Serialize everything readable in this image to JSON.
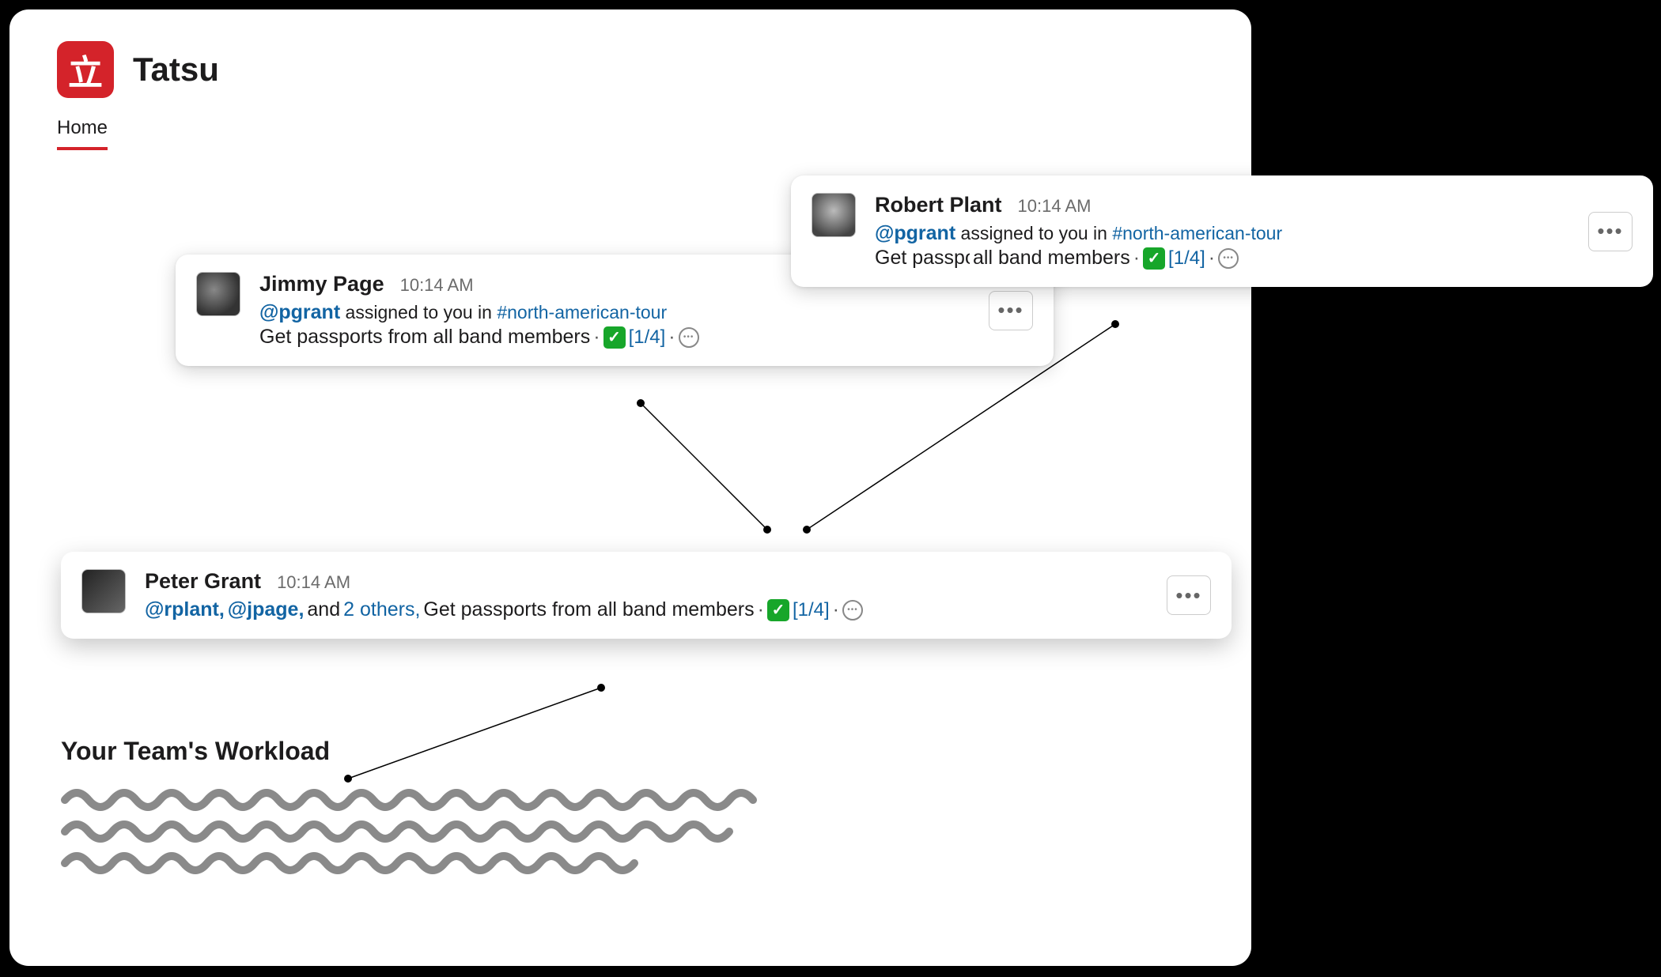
{
  "app": {
    "title": "Tatsu",
    "tab_home": "Home"
  },
  "cards": {
    "jimmy": {
      "name": "Jimmy Page",
      "time": "10:14 AM",
      "mention": "@pgrant",
      "assigned_phrase": "assigned to you in",
      "channel": "#north-american-tour",
      "task": "Get passports from all band members",
      "progress": "[1/4]"
    },
    "robert": {
      "name": "Robert Plant",
      "time": "10:14 AM",
      "mention": "@pgrant",
      "assigned_phrase": "assigned to you in",
      "channel": "#north-american-tour",
      "task": "Get passports from all band members",
      "progress": "[1/4]"
    },
    "peter": {
      "name": "Peter Grant",
      "time": "10:14 AM",
      "mention1": "@rplant,",
      "mention2": "@jpage,",
      "and_word": "and",
      "others": "2 others,",
      "task": "Get passports from all band members",
      "progress": "[1/4]"
    }
  },
  "section": {
    "workload_title": "Your Team's Workload"
  }
}
